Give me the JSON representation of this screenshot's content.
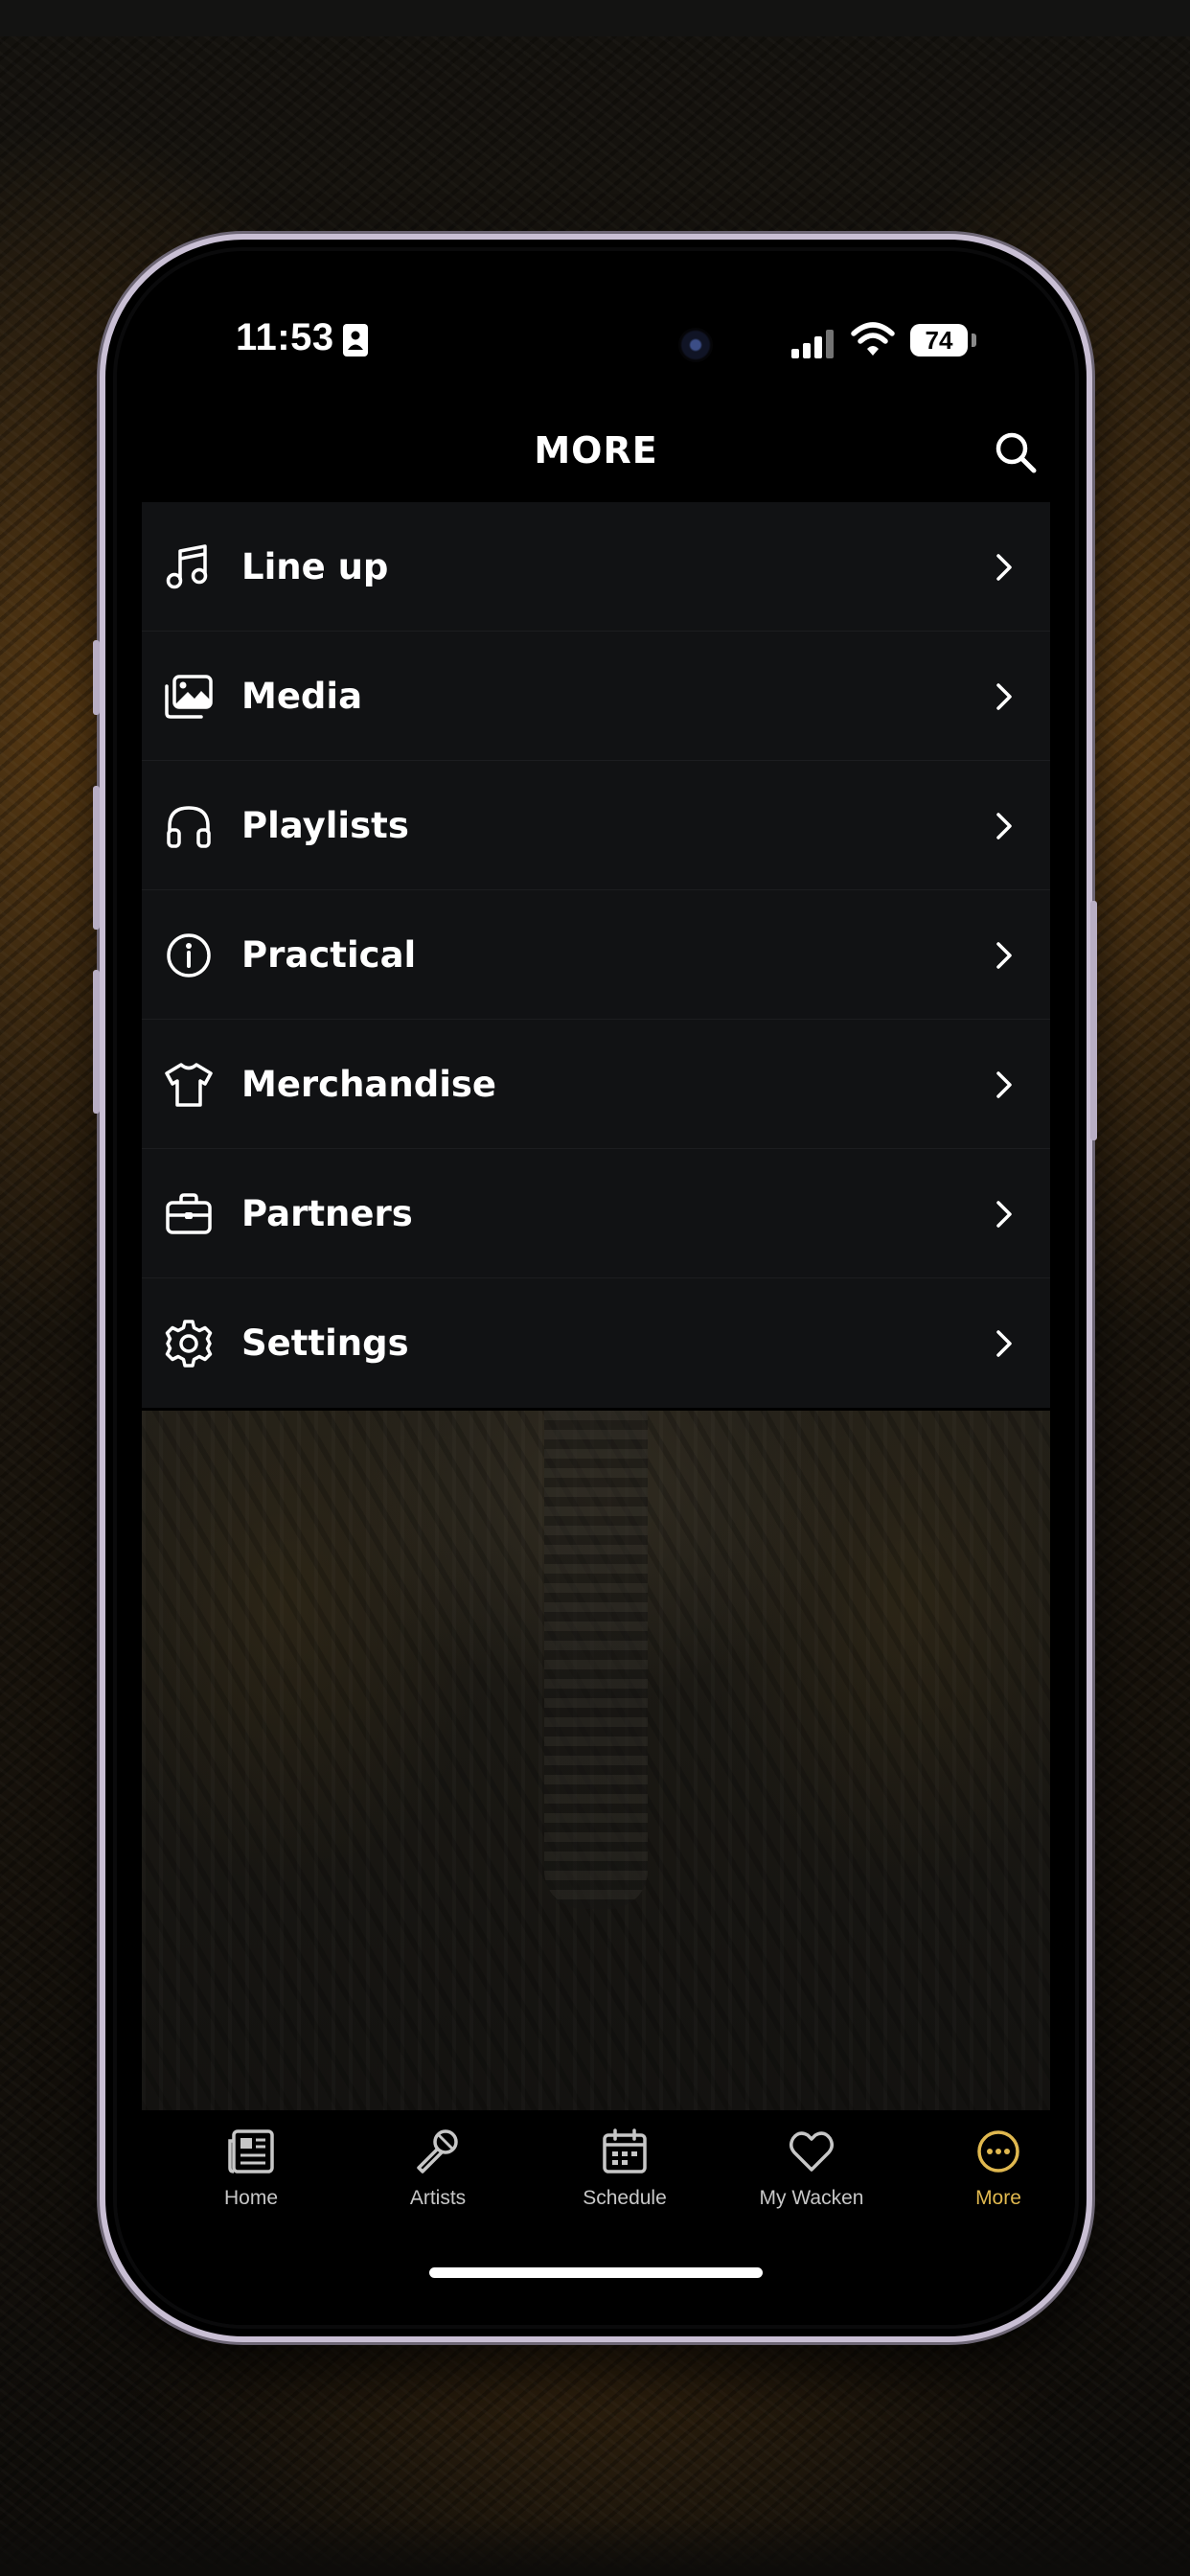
{
  "status_bar": {
    "time": "11:53",
    "battery": "74"
  },
  "header": {
    "title": "MORE"
  },
  "menu": {
    "items": [
      {
        "label": "Line up",
        "icon": "music-note-icon"
      },
      {
        "label": "Media",
        "icon": "images-icon"
      },
      {
        "label": "Playlists",
        "icon": "headphones-icon"
      },
      {
        "label": "Practical",
        "icon": "info-icon"
      },
      {
        "label": "Merchandise",
        "icon": "tshirt-icon"
      },
      {
        "label": "Partners",
        "icon": "briefcase-icon"
      },
      {
        "label": "Settings",
        "icon": "gear-icon"
      }
    ]
  },
  "tabbar": {
    "tabs": [
      {
        "label": "Home",
        "icon": "newspaper-icon"
      },
      {
        "label": "Artists",
        "icon": "microphone-icon"
      },
      {
        "label": "Schedule",
        "icon": "calendar-icon"
      },
      {
        "label": "My Wacken",
        "icon": "heart-icon"
      },
      {
        "label": "More",
        "icon": "more-dots-icon"
      }
    ],
    "active_tab": "More"
  },
  "colors": {
    "accent": "#e0b84f",
    "menu_background": "#111214",
    "screen_background": "#000000",
    "text": "#ffffff"
  }
}
